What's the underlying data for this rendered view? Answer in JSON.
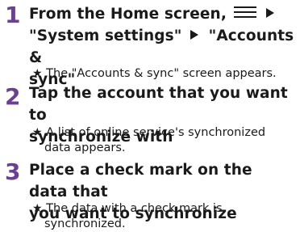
{
  "steps": [
    {
      "number": "1",
      "line1_text": "From the Home screen,",
      "line2_part1": "\"System settings\"",
      "line2_part2": "\"Accounts &",
      "line3": "sync\"",
      "note_star": "★",
      "note": "The \"Accounts & sync\" screen appears."
    },
    {
      "number": "2",
      "line1": "Tap the account that you want to",
      "line2": "synchronize with",
      "note_star": "★",
      "note_line1": "A list of online service's synchronized",
      "note_line2": "data appears."
    },
    {
      "number": "3",
      "line1": "Place a check mark on the data that",
      "line2": "you want to synchronize",
      "note_star": "★",
      "note_line1": "The data with a check mark is",
      "note_line2": "synchronized."
    }
  ],
  "icons": [
    "menu-icon",
    "triangle-right-icon"
  ]
}
